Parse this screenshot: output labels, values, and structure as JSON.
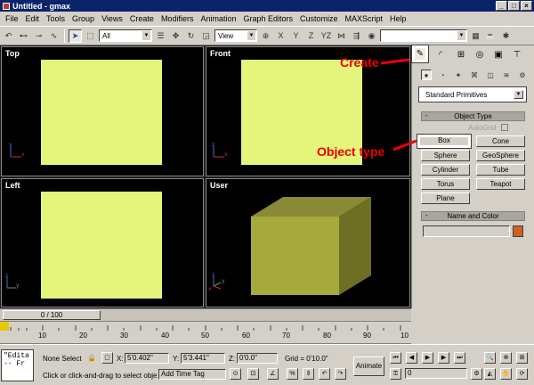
{
  "window": {
    "title": "Untitled - gmax",
    "min": "_",
    "max": "□",
    "close": "×"
  },
  "menu": [
    "File",
    "Edit",
    "Tools",
    "Group",
    "Views",
    "Create",
    "Modifiers",
    "Animation",
    "Graph Editors",
    "Customize",
    "MAXScript",
    "Help"
  ],
  "toolbar": {
    "selection_filter": "All",
    "ref_coord": "View",
    "axis_x": "X",
    "axis_y": "Y",
    "axis_z": "Z",
    "axis_yz": "YZ"
  },
  "viewports": {
    "top": "Top",
    "front": "Front",
    "left": "Left",
    "user": "User"
  },
  "panel": {
    "category_dropdown": "Standard Primitives",
    "object_type_header": "Object Type",
    "autogrid_label": "AutoGrid",
    "object_buttons": [
      "Box",
      "Cone",
      "Sphere",
      "GeoSphere",
      "Cylinder",
      "Tube",
      "Torus",
      "Teapot",
      "Plane"
    ],
    "name_color_header": "Name and Color",
    "name_value": "",
    "color_swatch": "#d06020"
  },
  "annotations": {
    "create": "Create",
    "object_type": "Object type"
  },
  "timeline": {
    "frame_label": "0 / 100",
    "ticks": [
      "10",
      "20",
      "30",
      "40",
      "50",
      "60",
      "70",
      "80",
      "90",
      "10"
    ]
  },
  "status": {
    "selection": "None Select",
    "x_label": "X:",
    "x_value": "5'0.402\"",
    "y_label": "Y:",
    "y_value": "5'3.441\"",
    "z_label": "Z:",
    "z_value": "0'0.0\"",
    "grid": "Grid = 0'10.0\"",
    "prompt": "Click or click-and-drag to select obje",
    "add_time_tag": "Add Time Tag",
    "animate": "Animate",
    "frame_field": "0",
    "script_line1": "\"Edita",
    "script_line2": "-- Fr"
  }
}
